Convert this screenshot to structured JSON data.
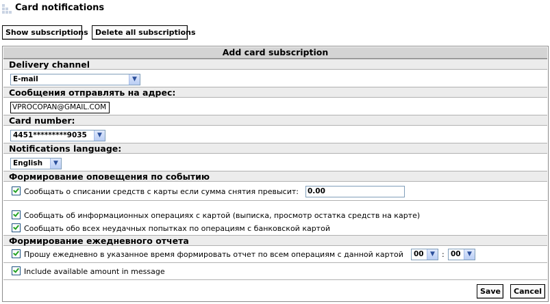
{
  "page": {
    "title": "Card notifications"
  },
  "toolbar": {
    "show_label": "Show subscriptions",
    "delete_label": "Delete all subscriptions"
  },
  "panel": {
    "title": "Add card subscription",
    "delivery": {
      "label": "Delivery channel",
      "value": "E-mail"
    },
    "address": {
      "label": "Сообщения отправлять на адрес:",
      "value": "VPROCOPAN@GMAIL.COM"
    },
    "card": {
      "label": "Card number:",
      "value": "4451*********9035"
    },
    "language": {
      "label": "Notifications language:",
      "value": "English"
    },
    "events": {
      "label": "Формирование оповещения по событию",
      "debit_label": "Сообщать о списании средств с карты если сумма снятия превысит:",
      "debit_checked": true,
      "threshold": "0.00",
      "info_label": "Сообщать об информационных операциях с картой (выписка, просмотр остатка средств на карте)",
      "info_checked": true,
      "fail_label": "Сообщать обо всех неудачных попытках по операциям с банковской картой",
      "fail_checked": true
    },
    "daily": {
      "label": "Формирование ежедневного отчета",
      "report_label": "Прошу ежедневно в указанное время формировать отчет по всем операциям с данной картой",
      "report_checked": true,
      "hour": "00",
      "separator": ":",
      "minute": "00",
      "amount_label": "Include available amount in message",
      "amount_checked": true
    },
    "save_label": "Save",
    "cancel_label": "Cancel"
  }
}
